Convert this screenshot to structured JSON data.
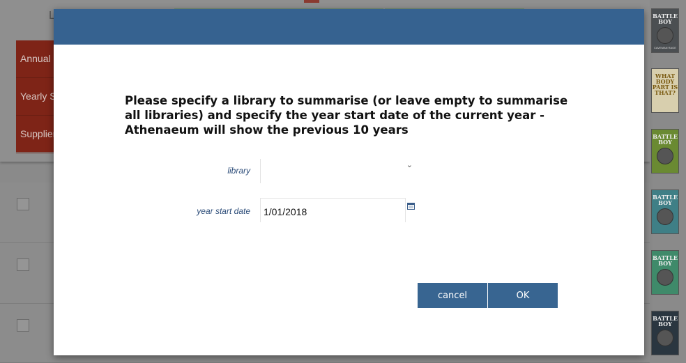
{
  "background": {
    "header_letter": "L",
    "menu_items": [
      "Annual S",
      "Yearly S",
      "Supplier"
    ],
    "book_covers": [
      {
        "title": "BATTLE BOY",
        "footer": "CAVEMAN RAGE",
        "color": "#4b4f52"
      },
      {
        "title": "WHAT BODY PART IS THAT?",
        "footer": "",
        "color": "#d8cfae"
      },
      {
        "title": "BATTLE BOY",
        "footer": "",
        "color": "#6a8a32"
      },
      {
        "title": "BATTLE BOY",
        "footer": "",
        "color": "#3f7f86"
      },
      {
        "title": "BATTLE BOY",
        "footer": "",
        "color": "#3f8a6a"
      },
      {
        "title": "BATTLE BOY",
        "footer": "",
        "color": "#2a3640"
      }
    ]
  },
  "dialog": {
    "message": "Please specify a library to summarise (or leave empty to summarise all libraries) and specify the year start date of the current year - Athenaeum will show the previous 10 years",
    "library_label": "library",
    "library_value": "",
    "year_start_label": "year start date",
    "year_start_value": "1/01/2018",
    "cancel_label": "cancel",
    "ok_label": "OK",
    "header_color": "#366290"
  },
  "colors": {
    "accent": "#366290",
    "menu": "#7e2417"
  }
}
